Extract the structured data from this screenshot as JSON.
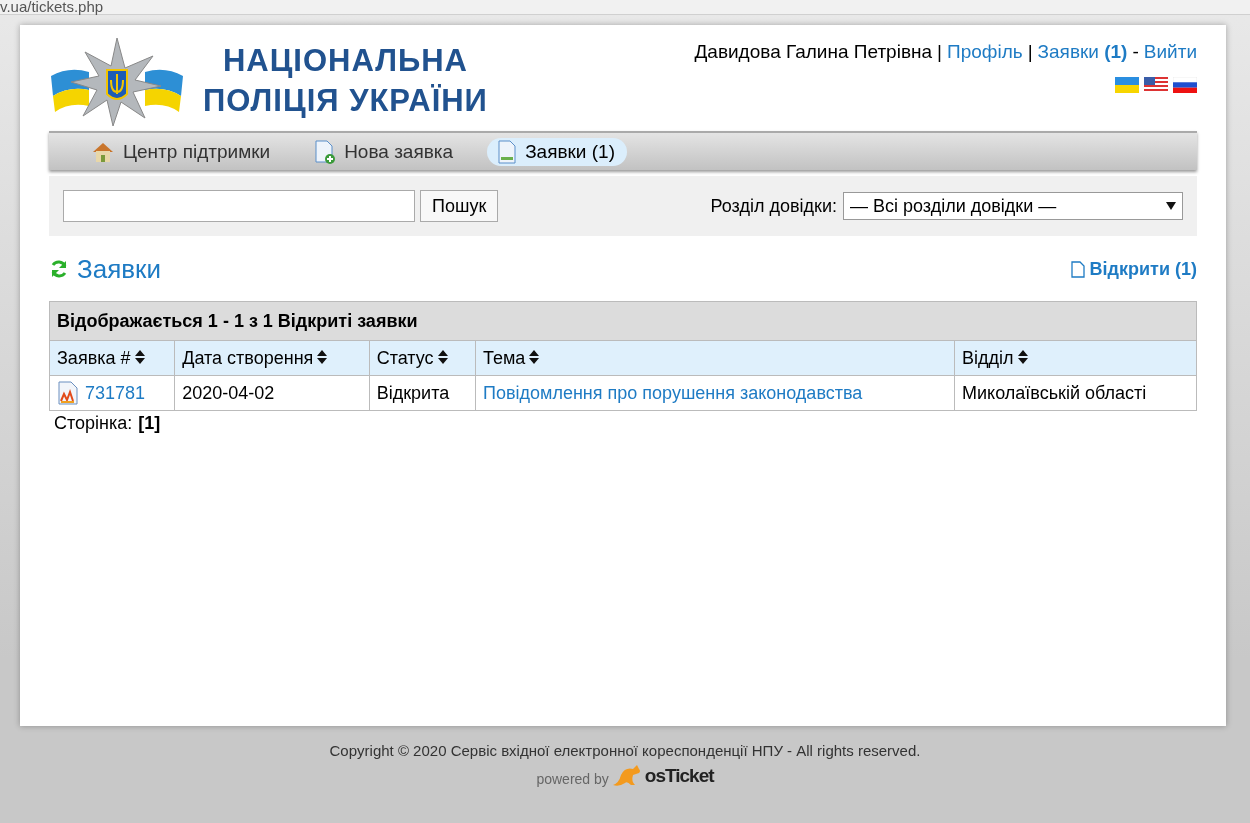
{
  "address_bar": {
    "url": "v.ua/tickets.php"
  },
  "header": {
    "logo_text": [
      "НАЦІОНАЛЬНА",
      "ПОЛІЦІЯ УКРАЇНИ"
    ],
    "user_name": "Давидова Галина Петрівна",
    "separator": "|",
    "profile_link": "Профіль",
    "tickets_link": "Заявки",
    "tickets_count": "(1)",
    "dash": "-",
    "logout_link": "Вийти",
    "languages": [
      {
        "kind": "ua"
      },
      {
        "kind": "us"
      },
      {
        "kind": "ru"
      }
    ]
  },
  "nav": [
    {
      "label": "Центр підтримки",
      "kind": "home",
      "selected": false
    },
    {
      "label": "Нова заявка",
      "kind": "new",
      "selected": false
    },
    {
      "label": "Заявки (1)",
      "kind": "tickets",
      "selected": true
    }
  ],
  "search": {
    "button": "Пошук",
    "topic_label": "Розділ довідки:",
    "topic_value": "— Всі розділи довідки —"
  },
  "heading": {
    "title": "Заявки",
    "open_link": "Відкрити (1)"
  },
  "table": {
    "caption": "Відображається 1 - 1 з 1 Відкриті заявки",
    "columns": [
      "Заявка #",
      "Дата створення",
      "Статус",
      "Тема",
      "Відділ"
    ],
    "rows": [
      {
        "number": "731781",
        "date": "2020-04-02",
        "status": "Відкрита",
        "subject": "Повідомлення про порушення законодавства",
        "department": "Миколаївській області"
      }
    ]
  },
  "pagination": {
    "label": "Сторінка:",
    "pages": "[1]"
  },
  "footer": {
    "copyright": "Copyright © 2020 Сервіс вхідної електронної кореспонденції НПУ - All rights reserved.",
    "powered_by": "powered by",
    "brand": "osTicket"
  }
}
